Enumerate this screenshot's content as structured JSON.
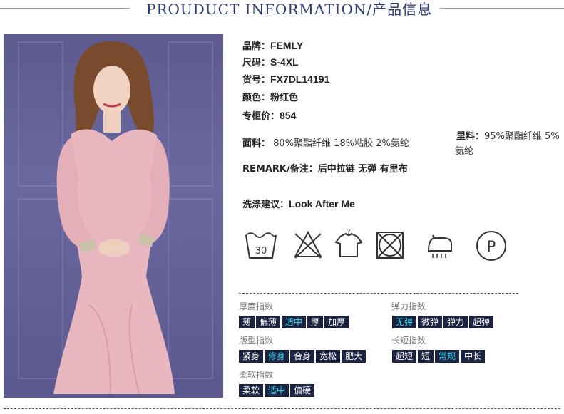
{
  "header": {
    "title": "PROUDUCT INFORMATION/产品信息"
  },
  "photo": {
    "alt": ""
  },
  "info": {
    "brand_label": "品牌：",
    "brand_value": "FEMLY",
    "size_label": "尺码：",
    "size_value": "S-4XL",
    "sku_label": "货号：",
    "sku_value": "FX7DL14191",
    "color_label": "颜色：",
    "color_value": "粉红色",
    "price_label": "专柜价：",
    "price_value": "854",
    "fabric_label": "面料：",
    "fabric_value": "80%聚酯纤维 18%粘胶 2%氨纶",
    "lining_label": "里料：",
    "lining_value_line1": "95%聚酯纤维 5%",
    "lining_value_line2": "氨纶",
    "remark_label": "REMARK/备注：",
    "remark_value": "后中拉链 无弹 有里布",
    "wash_label": "洗涤建议：",
    "wash_value": "Look After Me"
  },
  "care": {
    "icons": [
      "wash-30-icon",
      "no-bleach-icon",
      "no-tumble-icon",
      "no-dryclean-icon",
      "iron-steam-icon",
      "professional-clean-p-icon"
    ],
    "wash_temp": "30",
    "p_letter": "P"
  },
  "indices": {
    "thickness": {
      "title": "厚度指数",
      "options": [
        "薄",
        "偏薄",
        "适中",
        "厚",
        "加厚"
      ],
      "selected": 2
    },
    "elasticity": {
      "title": "弹力指数",
      "options": [
        "无弹",
        "微弹",
        "弹力",
        "超弹"
      ],
      "selected": 0
    },
    "fit": {
      "title": "版型指数",
      "options": [
        "紧身",
        "修身",
        "合身",
        "宽松",
        "肥大"
      ],
      "selected": 1
    },
    "length": {
      "title": "长短指数",
      "options": [
        "超短",
        "短",
        "常规",
        "中长"
      ],
      "selected": 2
    },
    "softness": {
      "title": "柔软指数",
      "options": [
        "柔软",
        "适中",
        "偏硬"
      ],
      "selected": 1
    }
  },
  "colors": {
    "accent_selected": "#2fd6ef",
    "chip_bg": "#1c2340",
    "title_color": "#2f3a78"
  }
}
